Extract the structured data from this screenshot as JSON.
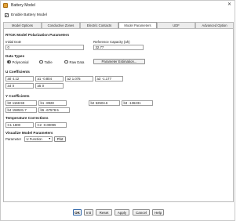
{
  "window": {
    "title": "Battery Model",
    "close_symbol": "✕"
  },
  "enable": {
    "label": "Enable Battery Model",
    "checked": true,
    "check_glyph": "✓"
  },
  "tabs": [
    {
      "label": "Model Options",
      "active": false
    },
    {
      "label": "Conductive Zones",
      "active": false
    },
    {
      "label": "Electric Contacts",
      "active": false
    },
    {
      "label": "Model Parameters",
      "active": true
    },
    {
      "label": "UDF",
      "active": false
    },
    {
      "label": "Advanced Option",
      "active": false
    }
  ],
  "rtgk": {
    "title": "RTGK Model Polarization Parameters",
    "initial_dod_label": "Initial DoD",
    "initial_dod_value": "0",
    "ref_capacity_label": "Reference Capacity (ah)",
    "ref_capacity_value": "32.77"
  },
  "data_types": {
    "title": "Data Types",
    "options": [
      {
        "label": "Polynomial",
        "selected": true
      },
      {
        "label": "Table",
        "selected": false
      },
      {
        "label": "Raw Data",
        "selected": false
      }
    ],
    "param_estimation_button": "Parameter Estimation..."
  },
  "u_coefficients": {
    "title": "U Coefficients",
    "rows": [
      [
        {
          "label": "a0",
          "value": "4.12"
        },
        {
          "label": "a1",
          "value": "-0.804"
        },
        {
          "label": "a2",
          "value": "1.075"
        },
        {
          "label": "a3",
          "value": "-1.177"
        }
      ],
      [
        {
          "label": "a4",
          "value": "0"
        },
        {
          "label": "a5",
          "value": "0"
        }
      ]
    ]
  },
  "y_coefficients": {
    "title": "Y Coefficients",
    "rows": [
      [
        {
          "label": "b0",
          "value": "1168.59"
        },
        {
          "label": "b1",
          "value": "-8928"
        },
        {
          "label": "b2",
          "value": "52504.6"
        },
        {
          "label": "b3",
          "value": "-136231"
        }
      ],
      [
        {
          "label": "b4",
          "value": "158531.7"
        },
        {
          "label": "b5",
          "value": "-67578.5"
        }
      ]
    ]
  },
  "temperature": {
    "title": "Temperature Corrections",
    "c1_label": "C1",
    "c1_value": "1800",
    "c2_label": "C2",
    "c2_value": "-0.00095"
  },
  "visualize": {
    "title": "Visualize Model Parameters",
    "parameter_label": "Parameter",
    "parameter_value": "U Function",
    "plot_button": "Plot"
  },
  "footer": {
    "ok": "OK",
    "init": "Init",
    "reset": "Reset",
    "apply": "Apply",
    "cancel": "Cancel",
    "help": "Help"
  }
}
